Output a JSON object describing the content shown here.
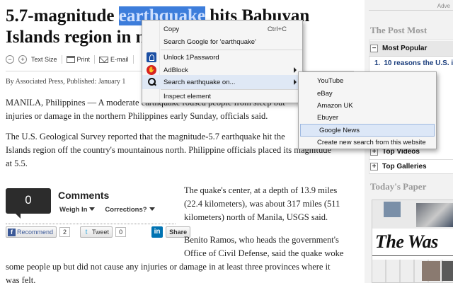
{
  "article": {
    "headline_line1_pre": "5.7-magnitude ",
    "headline_selected": "earthquake",
    "headline_line1_post": " hits Babuyan",
    "headline_line2": "Islands region in n",
    "toolbar": {
      "minus": "−",
      "plus": "+",
      "text_size": "Text Size",
      "print": "Print",
      "email": "E-mail"
    },
    "byline": "By Associated Press, Published: January 1",
    "paragraphs": [
      "MANILA, Philippines — A moderate earthquake roused people from sleep but",
      "injuries or damage in the northern Philippines early Sunday, officials said.",
      "The U.S. Geological Survey reported that the magnitude-5.7 earthquake hit the",
      "Islands region off the country's mountainous north. Philippine officials placed its magnitude",
      "at 5.5.",
      "The quake's center, at a depth of 13.9 miles",
      "(22.4 kilometers), was about 317 miles (511",
      "kilometers) north of Manila, USGS said.",
      "Benito Ramos, who heads the government's",
      "Office of Civil Defense, said the quake woke",
      "some people up but did not cause any injuries or damage in at least three provinces where it",
      "was felt."
    ],
    "comments": {
      "count": "0",
      "title": "Comments",
      "weigh_in": "Weigh In",
      "corrections": "Corrections?"
    },
    "social": {
      "recommend": "Recommend",
      "recommend_count": "2",
      "tweet": "Tweet",
      "tweet_count": "0",
      "share": "Share",
      "facebook_glyph": "f",
      "twitter_glyph": "t",
      "linkedin_glyph": "in"
    }
  },
  "sidebar": {
    "advert": "Adve",
    "post_most_title": "The Post Most",
    "most_popular": "Most Popular",
    "top_item_number": "1.",
    "top_item": "10 reasons the U.S. is",
    "top_videos": "Top Videos",
    "top_galleries": "Top Galleries",
    "todays_paper_title": "Today's Paper",
    "masthead": "The Was",
    "minus_glyph": "−",
    "plus_glyph": "+"
  },
  "context_menu": {
    "items": [
      {
        "label": "Copy",
        "shortcut": "Ctrl+C"
      },
      {
        "label": "Search Google for 'earthquake'"
      },
      {
        "label": "Unlock 1Password",
        "icon": "onepassword-icon"
      },
      {
        "label": "AdBlock",
        "icon": "adblock-icon",
        "submenu": true
      },
      {
        "label": "Search earthquake on...",
        "icon": "search-icon",
        "submenu": true,
        "highlighted": true
      },
      {
        "label": "Inspect element"
      }
    ]
  },
  "submenu": {
    "items": [
      {
        "label": "YouTube"
      },
      {
        "label": "eBay"
      },
      {
        "label": "Amazon UK"
      },
      {
        "label": "Ebuyer"
      },
      {
        "label": "Google News",
        "selected": true
      },
      {
        "label": "Create new search from this website"
      }
    ]
  },
  "colors": {
    "selection": "#3d7ddb",
    "menu_bg": "#f5f5f5",
    "menu_highlight": "#dfe8f5",
    "link": "#1a3d7c",
    "adblock_red": "#d8231f",
    "onepassword_blue": "#1b4fa3"
  }
}
